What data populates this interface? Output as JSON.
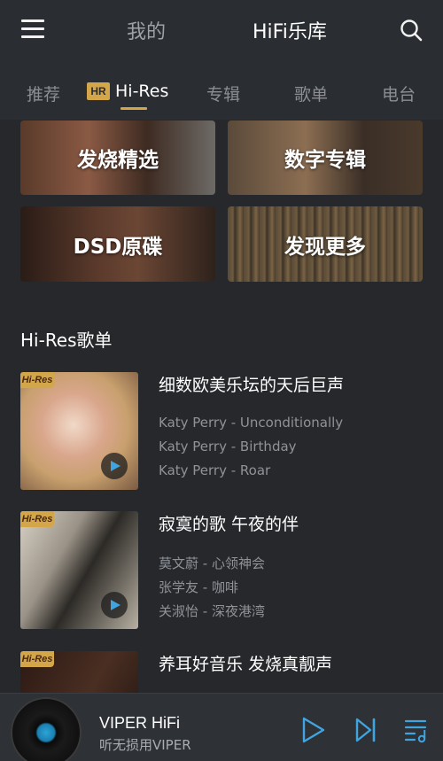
{
  "header": {
    "tabs": [
      {
        "label": "我的",
        "active": false
      },
      {
        "label": "HiFi乐库",
        "active": true
      }
    ]
  },
  "categories": {
    "badge": "HR",
    "items": [
      {
        "label": "推荐",
        "active": false
      },
      {
        "label": "Hi-Res",
        "active": true
      },
      {
        "label": "专辑",
        "active": false
      },
      {
        "label": "歌单",
        "active": false
      },
      {
        "label": "电台",
        "active": false
      }
    ]
  },
  "banners": [
    {
      "label": "发烧精选"
    },
    {
      "label": "数字专辑"
    },
    {
      "label": "DSD原碟"
    },
    {
      "label": "发现更多"
    }
  ],
  "section": {
    "title": "Hi-Res歌单",
    "badge": "Hi-Res"
  },
  "playlists": [
    {
      "title": "细数欧美乐坛的天后巨声",
      "tracks": [
        "Katy Perry - Unconditionally",
        "Katy Perry - Birthday",
        "Katy Perry - Roar"
      ]
    },
    {
      "title": "寂寞的歌 午夜的伴",
      "tracks": [
        "莫文蔚 - 心领神会",
        "张学友 - 咖啡",
        "关淑怡 - 深夜港湾"
      ]
    },
    {
      "title": "养耳好音乐 发烧真靓声",
      "tracks": []
    }
  ],
  "player": {
    "title": "VIPER HiFi",
    "subtitle": "听无损用VIPER"
  },
  "colors": {
    "accent": "#d4a64a",
    "background": "#26282c",
    "control_blue": "#3fa4e0"
  },
  "icons": [
    "menu-icon",
    "search-icon",
    "play-icon",
    "next-icon",
    "playlist-icon"
  ]
}
